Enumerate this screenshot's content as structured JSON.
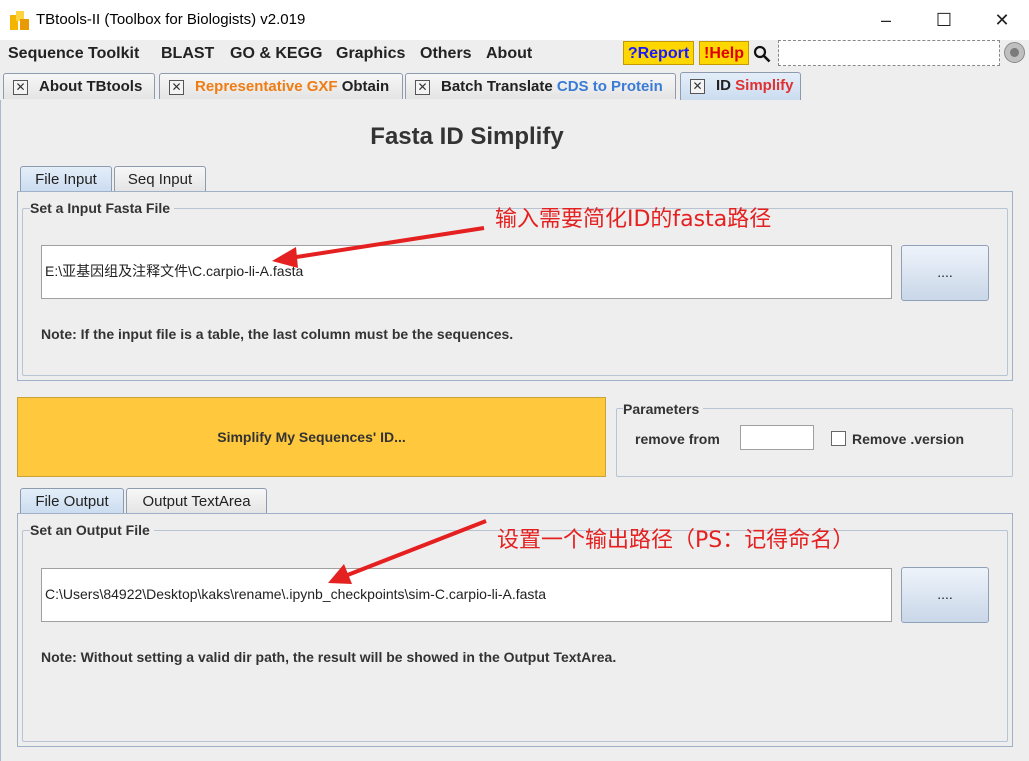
{
  "window": {
    "title": "TBtools-II (Toolbox for Biologists) v2.019",
    "minimize": "–",
    "maximize": "☐",
    "close": "✕"
  },
  "menu": {
    "items": [
      "Sequence Toolkit",
      "BLAST",
      "GO & KEGG",
      "Graphics",
      "Others",
      "About"
    ],
    "report": "?Report",
    "help": "!Help"
  },
  "tabs": [
    {
      "close": "✕",
      "parts": [
        {
          "text": "About TBtools",
          "color": "#222222"
        }
      ]
    },
    {
      "close": "✕",
      "parts": [
        {
          "text": "Representative GXF ",
          "color": "#f07d14"
        },
        {
          "text": "Obtain",
          "color": "#222222"
        }
      ]
    },
    {
      "close": "✕",
      "parts": [
        {
          "text": "Batch Translate ",
          "color": "#222222"
        },
        {
          "text": "CDS to Protein",
          "color": "#3a7bd5"
        }
      ]
    },
    {
      "close": "✕",
      "parts": [
        {
          "text": "ID ",
          "color": "#222222"
        },
        {
          "text": "Simplify",
          "color": "#e03030"
        }
      ]
    }
  ],
  "heading": "Fasta ID Simplify",
  "input": {
    "tabs": [
      "File Input",
      "Seq Input"
    ],
    "group_label": "Set a Input Fasta File",
    "path": "E:\\亚基因组及注释文件\\C.carpio-li-A.fasta",
    "browse": "....",
    "note": "Note: If the input file is a table, the last column must be the sequences."
  },
  "run_button": "Simplify My Sequences' ID...",
  "parameters": {
    "label": "Parameters",
    "remove_from_label": "remove from",
    "remove_from_value": "",
    "remove_version_label": "Remove .version",
    "remove_version_checked": false
  },
  "output": {
    "tabs": [
      "File Output",
      "Output TextArea"
    ],
    "group_label": "Set an Output File",
    "path": "C:\\Users\\84922\\Desktop\\kaks\\rename\\.ipynb_checkpoints\\sim-C.carpio-li-A.fasta",
    "browse": "....",
    "note": "Note: Without setting a valid dir path, the result will be showed in the Output TextArea."
  },
  "annotations": {
    "input_hint": "输入需要简化ID的fasta路径",
    "output_hint": "设置一个输出路径（PS：记得命名）",
    "color": "#e52020"
  }
}
